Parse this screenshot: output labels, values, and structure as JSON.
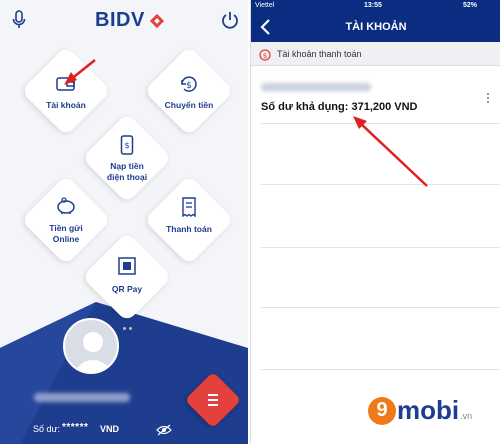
{
  "left_screen": {
    "logo_text": "BIDV",
    "tiles": [
      {
        "label_1": "Tài khoản",
        "label_2": ""
      },
      {
        "label_1": "Chuyển tiền",
        "label_2": ""
      },
      {
        "label_1": "Nạp tiền",
        "label_2": "điện thoại"
      },
      {
        "label_1": "Tiền gửi",
        "label_2": "Online"
      },
      {
        "label_1": "Thanh toán",
        "label_2": ""
      },
      {
        "label_1": "QR Pay",
        "label_2": ""
      }
    ],
    "balance_label": "Số dư:",
    "balance_masked": "******",
    "balance_currency": "VND"
  },
  "right_screen": {
    "status": {
      "carrier": "Viettel",
      "time": "13:55",
      "battery": "52%"
    },
    "title": "TÀI KHOẢN",
    "section_label": "Tài khoản thanh toán",
    "available_balance": "Số dư khả dụng: 371,200 VND"
  },
  "watermark": {
    "digit": "9",
    "brand": "mobi",
    "suffix": ".vn"
  },
  "colors": {
    "primary": "#1f3d8f",
    "nav": "#0a2d82",
    "accent": "#e5413c",
    "arrow": "#e02020"
  }
}
